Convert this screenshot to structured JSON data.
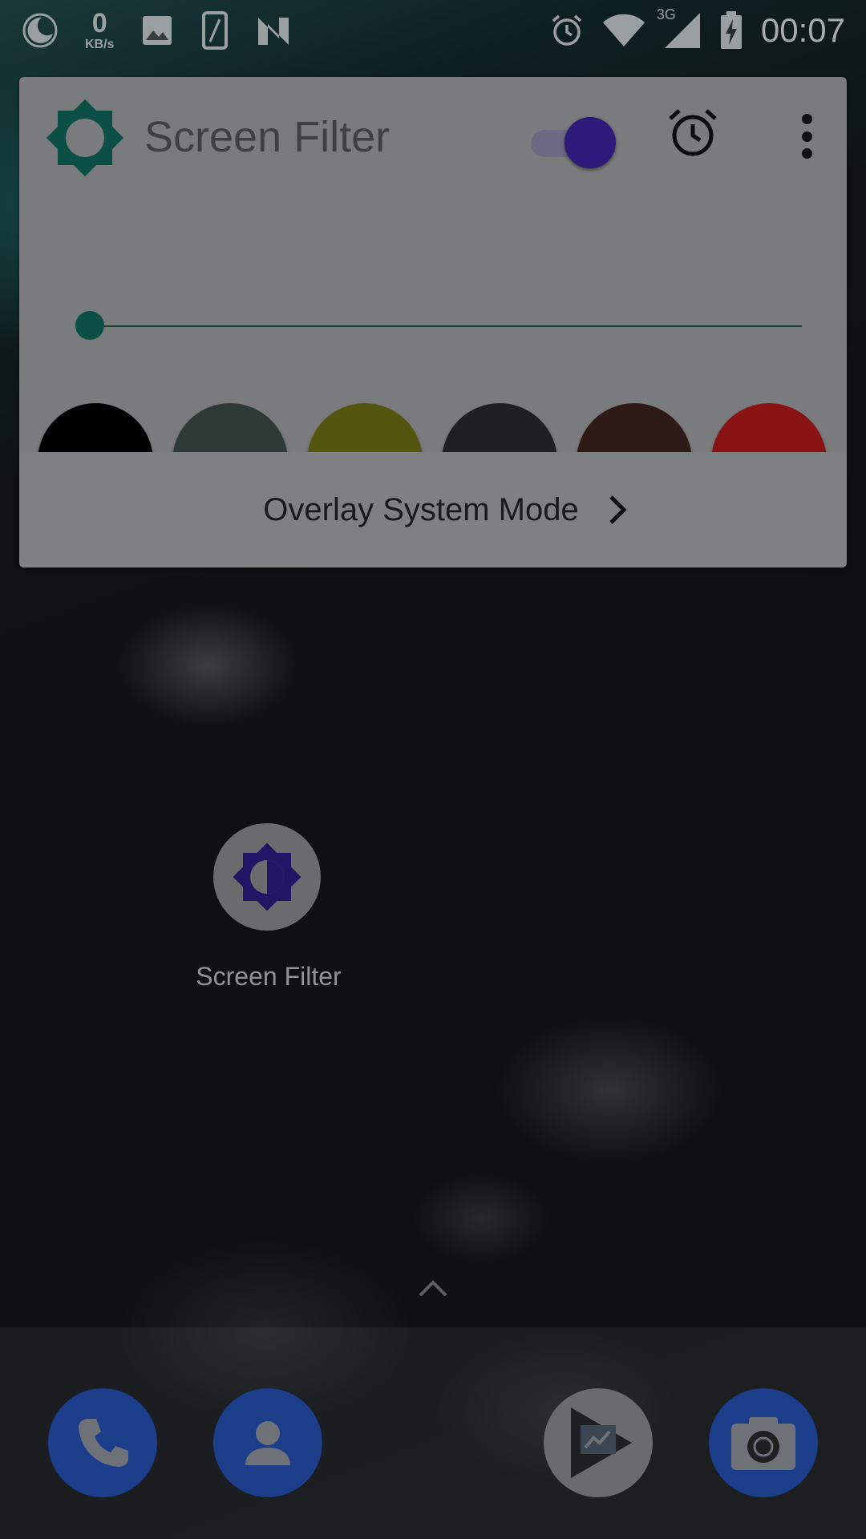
{
  "status_bar": {
    "net_speed_value": "0",
    "net_speed_unit": "KB/s",
    "network_type": "3G",
    "time": "00:07",
    "icons": [
      "night-mode-icon",
      "net-speed",
      "gallery-icon",
      "phone-outline-icon",
      "nova-n-icon",
      "alarm-icon",
      "wifi-icon",
      "signal-icon",
      "battery-charging-icon"
    ]
  },
  "widget": {
    "title": "Screen Filter",
    "toggle_on": true,
    "intensity_percent": 0,
    "colors": [
      "#000000",
      "#2d3a36",
      "#54560f",
      "#1f2021",
      "#2e1a17",
      "#8a1414"
    ],
    "overlay_mode_label": "Overlay System Mode"
  },
  "home": {
    "app_label": "Screen Filter"
  },
  "dock": {
    "items": [
      "phone",
      "contacts",
      "play-store",
      "camera"
    ]
  },
  "theme": {
    "accent": "#0b4f46",
    "toggle_thumb": "#2d1a7a",
    "dock_blue": "#1b3d8a"
  }
}
